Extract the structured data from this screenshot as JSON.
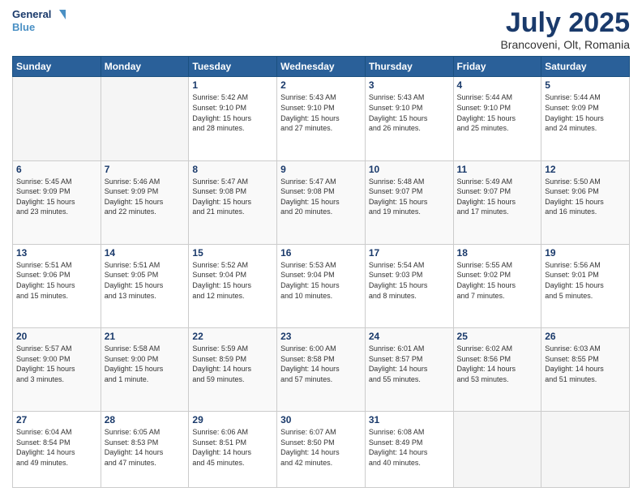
{
  "header": {
    "logo_line1": "General",
    "logo_line2": "Blue",
    "title": "July 2025",
    "subtitle": "Brancoveni, Olt, Romania"
  },
  "weekdays": [
    "Sunday",
    "Monday",
    "Tuesday",
    "Wednesday",
    "Thursday",
    "Friday",
    "Saturday"
  ],
  "weeks": [
    [
      {
        "day": "",
        "content": ""
      },
      {
        "day": "",
        "content": ""
      },
      {
        "day": "1",
        "content": "Sunrise: 5:42 AM\nSunset: 9:10 PM\nDaylight: 15 hours\nand 28 minutes."
      },
      {
        "day": "2",
        "content": "Sunrise: 5:43 AM\nSunset: 9:10 PM\nDaylight: 15 hours\nand 27 minutes."
      },
      {
        "day": "3",
        "content": "Sunrise: 5:43 AM\nSunset: 9:10 PM\nDaylight: 15 hours\nand 26 minutes."
      },
      {
        "day": "4",
        "content": "Sunrise: 5:44 AM\nSunset: 9:10 PM\nDaylight: 15 hours\nand 25 minutes."
      },
      {
        "day": "5",
        "content": "Sunrise: 5:44 AM\nSunset: 9:09 PM\nDaylight: 15 hours\nand 24 minutes."
      }
    ],
    [
      {
        "day": "6",
        "content": "Sunrise: 5:45 AM\nSunset: 9:09 PM\nDaylight: 15 hours\nand 23 minutes."
      },
      {
        "day": "7",
        "content": "Sunrise: 5:46 AM\nSunset: 9:09 PM\nDaylight: 15 hours\nand 22 minutes."
      },
      {
        "day": "8",
        "content": "Sunrise: 5:47 AM\nSunset: 9:08 PM\nDaylight: 15 hours\nand 21 minutes."
      },
      {
        "day": "9",
        "content": "Sunrise: 5:47 AM\nSunset: 9:08 PM\nDaylight: 15 hours\nand 20 minutes."
      },
      {
        "day": "10",
        "content": "Sunrise: 5:48 AM\nSunset: 9:07 PM\nDaylight: 15 hours\nand 19 minutes."
      },
      {
        "day": "11",
        "content": "Sunrise: 5:49 AM\nSunset: 9:07 PM\nDaylight: 15 hours\nand 17 minutes."
      },
      {
        "day": "12",
        "content": "Sunrise: 5:50 AM\nSunset: 9:06 PM\nDaylight: 15 hours\nand 16 minutes."
      }
    ],
    [
      {
        "day": "13",
        "content": "Sunrise: 5:51 AM\nSunset: 9:06 PM\nDaylight: 15 hours\nand 15 minutes."
      },
      {
        "day": "14",
        "content": "Sunrise: 5:51 AM\nSunset: 9:05 PM\nDaylight: 15 hours\nand 13 minutes."
      },
      {
        "day": "15",
        "content": "Sunrise: 5:52 AM\nSunset: 9:04 PM\nDaylight: 15 hours\nand 12 minutes."
      },
      {
        "day": "16",
        "content": "Sunrise: 5:53 AM\nSunset: 9:04 PM\nDaylight: 15 hours\nand 10 minutes."
      },
      {
        "day": "17",
        "content": "Sunrise: 5:54 AM\nSunset: 9:03 PM\nDaylight: 15 hours\nand 8 minutes."
      },
      {
        "day": "18",
        "content": "Sunrise: 5:55 AM\nSunset: 9:02 PM\nDaylight: 15 hours\nand 7 minutes."
      },
      {
        "day": "19",
        "content": "Sunrise: 5:56 AM\nSunset: 9:01 PM\nDaylight: 15 hours\nand 5 minutes."
      }
    ],
    [
      {
        "day": "20",
        "content": "Sunrise: 5:57 AM\nSunset: 9:00 PM\nDaylight: 15 hours\nand 3 minutes."
      },
      {
        "day": "21",
        "content": "Sunrise: 5:58 AM\nSunset: 9:00 PM\nDaylight: 15 hours\nand 1 minute."
      },
      {
        "day": "22",
        "content": "Sunrise: 5:59 AM\nSunset: 8:59 PM\nDaylight: 14 hours\nand 59 minutes."
      },
      {
        "day": "23",
        "content": "Sunrise: 6:00 AM\nSunset: 8:58 PM\nDaylight: 14 hours\nand 57 minutes."
      },
      {
        "day": "24",
        "content": "Sunrise: 6:01 AM\nSunset: 8:57 PM\nDaylight: 14 hours\nand 55 minutes."
      },
      {
        "day": "25",
        "content": "Sunrise: 6:02 AM\nSunset: 8:56 PM\nDaylight: 14 hours\nand 53 minutes."
      },
      {
        "day": "26",
        "content": "Sunrise: 6:03 AM\nSunset: 8:55 PM\nDaylight: 14 hours\nand 51 minutes."
      }
    ],
    [
      {
        "day": "27",
        "content": "Sunrise: 6:04 AM\nSunset: 8:54 PM\nDaylight: 14 hours\nand 49 minutes."
      },
      {
        "day": "28",
        "content": "Sunrise: 6:05 AM\nSunset: 8:53 PM\nDaylight: 14 hours\nand 47 minutes."
      },
      {
        "day": "29",
        "content": "Sunrise: 6:06 AM\nSunset: 8:51 PM\nDaylight: 14 hours\nand 45 minutes."
      },
      {
        "day": "30",
        "content": "Sunrise: 6:07 AM\nSunset: 8:50 PM\nDaylight: 14 hours\nand 42 minutes."
      },
      {
        "day": "31",
        "content": "Sunrise: 6:08 AM\nSunset: 8:49 PM\nDaylight: 14 hours\nand 40 minutes."
      },
      {
        "day": "",
        "content": ""
      },
      {
        "day": "",
        "content": ""
      }
    ]
  ]
}
